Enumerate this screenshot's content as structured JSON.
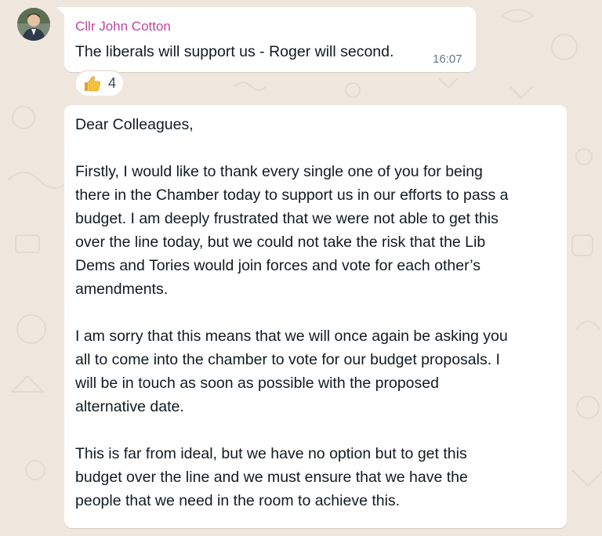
{
  "theme": {
    "chat_bg": "#efe7de",
    "bubble_bg": "#ffffff",
    "sender_color": "#c2459b",
    "time_color": "#667781"
  },
  "message1": {
    "sender": "Cllr John Cotton",
    "text": "The liberals will support us - Roger will second.",
    "time": "16:07",
    "reaction": {
      "icon": "thumbs-up-icon",
      "count": "4"
    }
  },
  "message2": {
    "greeting": "Dear Colleagues,",
    "paragraph1": [
      "Firstly, I would like to thank every single one of you for being",
      "there in the Chamber today to support us in our efforts to pass a",
      "budget. I am deeply frustrated that we were not able to get this",
      "over the line today, but we could not take the risk that the Lib",
      "Dems and Tories would join forces and vote for each other’s",
      "amendments."
    ],
    "paragraph2": [
      "I am sorry that this means that we will once again be asking you",
      "all to come into the chamber to vote for our budget proposals. I",
      "will be in touch as soon as possible with the proposed",
      "alternative date."
    ],
    "paragraph3": [
      "This is far from ideal, but we have no option but to get this",
      "budget over the line and we must ensure that we have the",
      "people that we need in the room to achieve this."
    ]
  }
}
